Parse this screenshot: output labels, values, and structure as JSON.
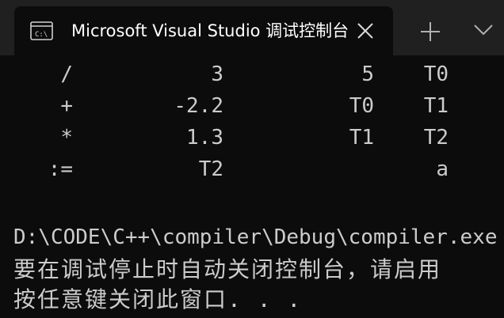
{
  "window": {
    "tab_title": "Microsoft Visual Studio 调试控制台",
    "tab_icon": "console-app-icon",
    "close_icon": "close-icon",
    "new_tab_icon": "plus-icon",
    "dropdown_icon": "chevron-down-icon",
    "colors": {
      "titlebar": "#202020",
      "console_bg": "#0c0c0c",
      "text": "#cccccc"
    }
  },
  "quadruples": [
    {
      "op": "/",
      "arg1": "3",
      "arg2": "5",
      "result": "T0"
    },
    {
      "op": "+",
      "arg1": "-2.2",
      "arg2": "T0",
      "result": "T1"
    },
    {
      "op": "*",
      "arg1": "1.3",
      "arg2": "T1",
      "result": "T2"
    },
    {
      "op": ":=",
      "arg1": "T2",
      "arg2": "",
      "result": "a"
    }
  ],
  "console": {
    "path_line": "D:\\CODE\\C++\\compiler\\Debug\\compiler.exe",
    "hint_line_1": "要在调试停止时自动关闭控制台，请启用",
    "hint_line_2": "按任意键关闭此窗口. . ."
  }
}
